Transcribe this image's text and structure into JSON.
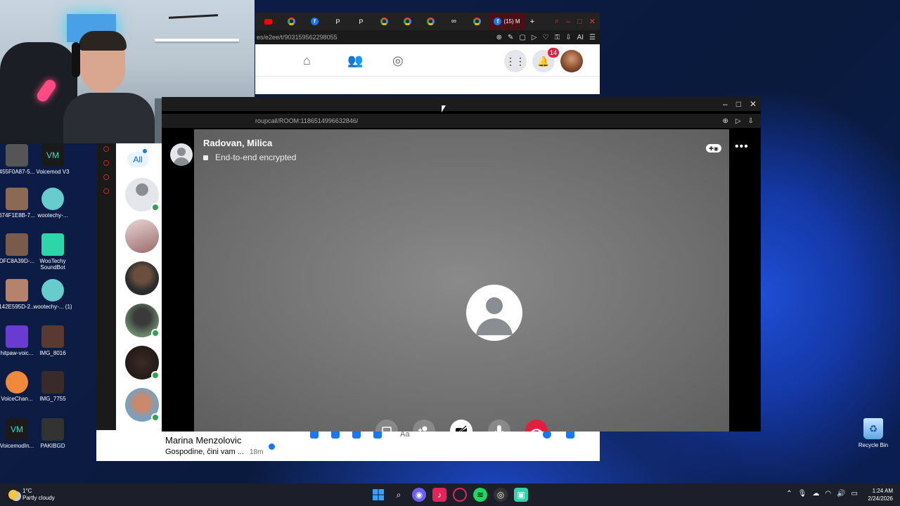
{
  "browser": {
    "active_tab_label": "(15) M",
    "url": "es/e2ee/t/903159562298055",
    "notification_count": "14"
  },
  "chat_filter": {
    "all_label": "All"
  },
  "call_window": {
    "url": "roupcall/ROOM:1186514996632846/",
    "call_name": "Radovan, Milica",
    "encryption_label": "End-to-end encrypted"
  },
  "last_chat": {
    "name": "Marina Menzolovic",
    "preview": "Gospodine, čini vam ...",
    "time": "18m"
  },
  "composer": {
    "placeholder": "Aa"
  },
  "desktop_icons": [
    {
      "label": "455F0A87-5..."
    },
    {
      "label": "Voicemod V3"
    },
    {
      "label": "674F1E8B-7..."
    },
    {
      "label": "wootechy-..."
    },
    {
      "label": "DFC8A39D-..."
    },
    {
      "label": "WooTechy SoundBot"
    },
    {
      "label": "142E595D-2..."
    },
    {
      "label": "wootechy-... (1)"
    },
    {
      "label": "hitpaw-voic..."
    },
    {
      "label": "IMG_8016"
    },
    {
      "label": "VoiceChan..."
    },
    {
      "label": "IMG_7755"
    },
    {
      "label": "VoicemodIn..."
    },
    {
      "label": "PAKIBGD"
    }
  ],
  "recycle_bin": {
    "label": "Recycle Bin"
  },
  "taskbar": {
    "temperature": "1°C",
    "weather": "Partly cloudy",
    "time": "1:24 AM",
    "date": "2/24/2026"
  },
  "colors": {
    "messenger_blue": "#1877f2",
    "end_call_red": "#e41e3f",
    "online_green": "#31a24c"
  }
}
